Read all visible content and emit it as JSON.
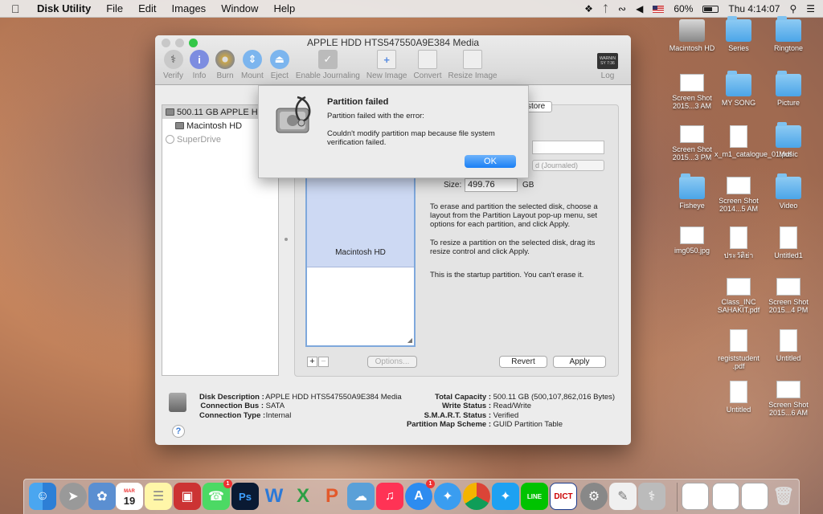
{
  "menubar": {
    "app_name": "Disk Utility",
    "menus": [
      "File",
      "Edit",
      "Images",
      "Window",
      "Help"
    ],
    "battery": "60%",
    "clock": "Thu 4:14:07"
  },
  "window": {
    "title": "APPLE HDD HTS547550A9E384 Media",
    "toolbar": [
      "Verify",
      "Info",
      "Burn",
      "Mount",
      "Eject",
      "Enable Journaling",
      "New Image",
      "Convert",
      "Resize Image"
    ],
    "log_label": "Log",
    "log_badge_line1": "WARNIN",
    "log_badge_line2": "SY 7:36"
  },
  "sidebar": {
    "disk": "500.11 GB APPLE HD",
    "volume": "Macintosh HD",
    "optical": "SuperDrive"
  },
  "partition": {
    "tab_restore": "store",
    "format_partial": "d (Journaled)",
    "size_label": "Size:",
    "size_value": "499.76",
    "size_unit": "GB",
    "volume_name": "Macintosh HD",
    "info1": "To erase and partition the selected disk, choose a layout from the Partition Layout pop-up menu, set options for each partition, and click Apply.",
    "info2": "To resize a partition on the selected disk, drag its resize control and click Apply.",
    "info3": "This is the startup partition. You can't erase it.",
    "plus": "+",
    "minus": "−",
    "options_btn": "Options...",
    "revert_btn": "Revert",
    "apply_btn": "Apply"
  },
  "details": {
    "disk_description_label": "Disk Description :",
    "disk_description": "APPLE HDD HTS547550A9E384 Media",
    "connection_bus_label": "Connection Bus :",
    "connection_bus": "SATA",
    "connection_type_label": "Connection Type :",
    "connection_type": "Internal",
    "total_capacity_label": "Total Capacity :",
    "total_capacity": "500.11 GB (500,107,862,016 Bytes)",
    "write_status_label": "Write Status :",
    "write_status": "Read/Write",
    "smart_label": "S.M.A.R.T. Status :",
    "smart": "Verified",
    "scheme_label": "Partition Map Scheme :",
    "scheme": "GUID Partition Table",
    "help": "?"
  },
  "alert": {
    "title": "Partition failed",
    "message": "Partition failed with the error:",
    "detail": "Couldn't modify partition map because file system verification failed.",
    "ok": "OK"
  },
  "desktop": [
    {
      "label": "Macintosh HD",
      "kind": "harddisk"
    },
    {
      "label": "Series",
      "kind": "folder"
    },
    {
      "label": "Ringtone",
      "kind": "folder"
    },
    {
      "label": "Screen Shot 2015...3 AM",
      "kind": "shot"
    },
    {
      "label": "MY SONG",
      "kind": "folder"
    },
    {
      "label": "Picture",
      "kind": "folder"
    },
    {
      "label": "Screen Shot 2015...3 PM",
      "kind": "shot"
    },
    {
      "label": "x_m1_catalogue_01.pdf",
      "kind": "doc"
    },
    {
      "label": "Music",
      "kind": "folder"
    },
    {
      "label": "Fisheye",
      "kind": "folder"
    },
    {
      "label": "Screen Shot 2014...5 AM",
      "kind": "shot"
    },
    {
      "label": "Video",
      "kind": "folder"
    },
    {
      "label": "img050.jpg",
      "kind": "shot"
    },
    {
      "label": "ประวัติย่า",
      "kind": "doc"
    },
    {
      "label": "Untitled1",
      "kind": "doc"
    },
    {
      "label": "Class_INC SAHAKIT.pdf",
      "kind": "shot"
    },
    {
      "label": "Screen Shot 2015...4 PM",
      "kind": "shot"
    },
    {
      "label": "registstudent .pdf",
      "kind": "doc"
    },
    {
      "label": "Untitled",
      "kind": "doc"
    },
    {
      "label": "Untitled",
      "kind": "doc"
    },
    {
      "label": "Screen Shot 2015...6 AM",
      "kind": "shot"
    }
  ],
  "dock": {
    "calendar_month": "MAR",
    "calendar_day": "19",
    "facetime_badge": "1",
    "appstore_badge": "1",
    "ps_label": "Ps",
    "word_label": "W",
    "excel_label": "X",
    "ppt_label": "P",
    "line_label": "LINE",
    "dict_label": "DICT",
    "accent": "#1a7ff5"
  }
}
